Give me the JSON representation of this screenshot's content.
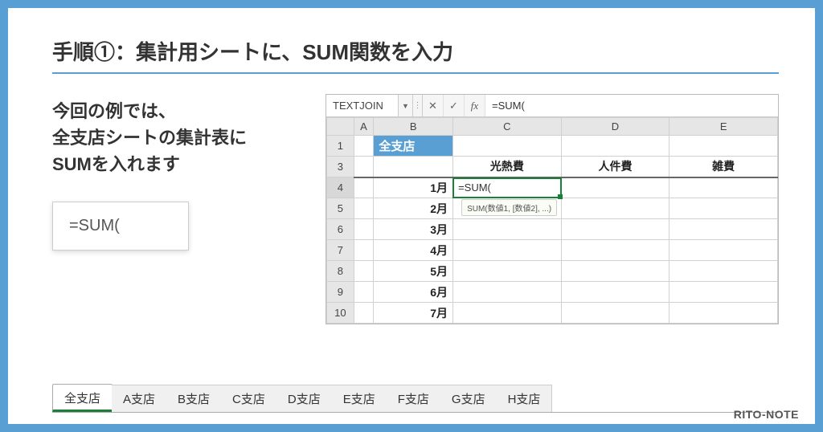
{
  "heading": "手順①：集計用シートに、SUM関数を入力",
  "description_lines": [
    "今回の例では、",
    "全支店シートの集計表に",
    "SUMを入れます"
  ],
  "formula_box": "=SUM(",
  "excel": {
    "name_box": "TEXTJOIN",
    "fx_value": "=SUM(",
    "columns": [
      "A",
      "B",
      "C",
      "D",
      "E"
    ],
    "title_cell": "全支店",
    "headers": [
      "光熱費",
      "人件費",
      "雑費"
    ],
    "months": [
      "1月",
      "2月",
      "3月",
      "4月",
      "5月",
      "6月",
      "7月"
    ],
    "active_value": "=SUM(",
    "tooltip": "SUM(数値1, [数値2], ...)",
    "row_ids": [
      "1",
      "3",
      "4",
      "5",
      "6",
      "7",
      "8",
      "9",
      "10"
    ]
  },
  "sheet_tabs": [
    "全支店",
    "A支店",
    "B支店",
    "C支店",
    "D支店",
    "E支店",
    "F支店",
    "G支店",
    "H支店"
  ],
  "active_tab_index": 0,
  "watermark": "RITO-NOTE",
  "icons": {
    "cancel": "✕",
    "enter": "✓",
    "fx": "fx",
    "dropdown": "▼",
    "dots": "⋮"
  }
}
